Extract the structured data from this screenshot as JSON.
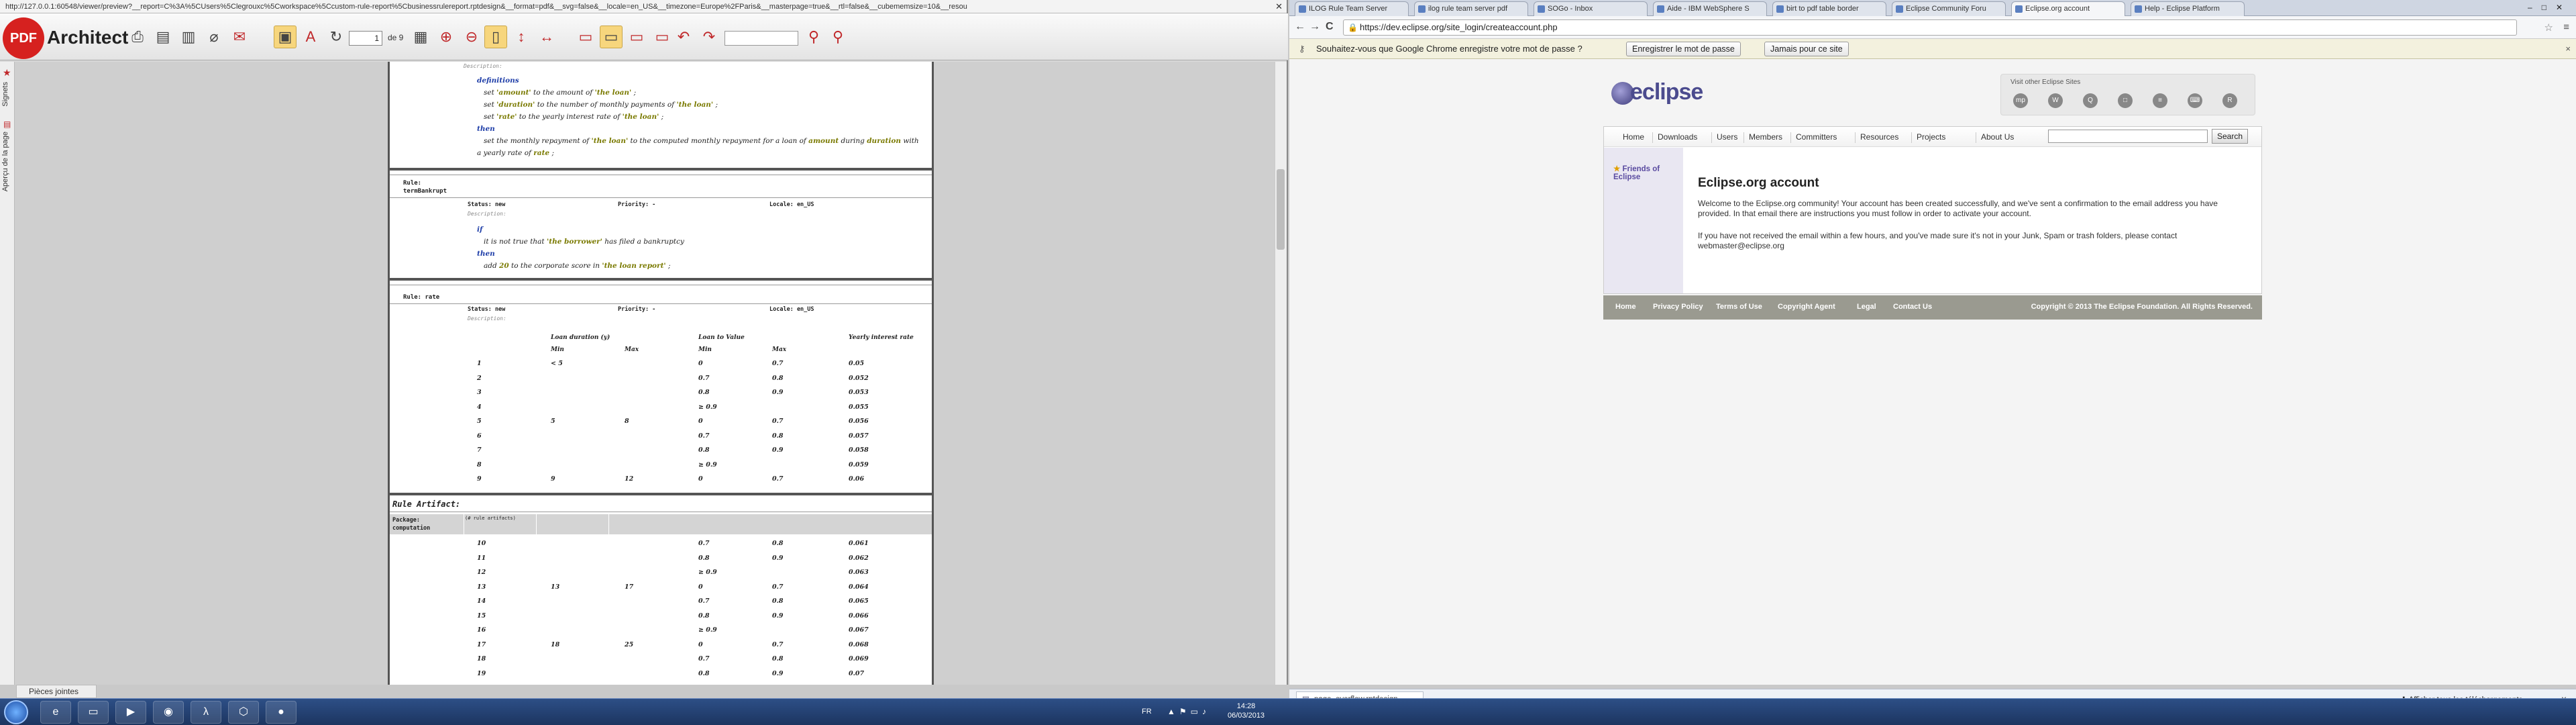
{
  "left_window": {
    "url": "http://127.0.0.1:60548/viewer/preview?__report=C%3A%5CUsers%5Clegrouxc%5Cworkspace%5Ccustom-rule-report%5Cbusinessrulereport.rptdesign&__format=pdf&__svg=false&__locale=en_US&__timezone=Europe%2FParis&__masterpage=true&__rtl=false&__cubememsize=10&__resou",
    "close": "✕",
    "brand": "Architect",
    "logo_text": "PDF",
    "page_current": "1",
    "page_of": "de 9",
    "side_tabs": [
      "Signets",
      "Aperçu de la page"
    ],
    "attachments": "Pièces jointes",
    "toolbar_icons": [
      "print-icon",
      "save-icon",
      "scan-icon",
      "attach-icon",
      "email-icon",
      "highlight-icon",
      "text-icon",
      "rotate-icon",
      "zoom-in-icon",
      "zoom-out-icon",
      "single-page-icon",
      "fit-height-icon",
      "fit-width-icon",
      "layout1-icon",
      "layout2-icon",
      "layout3-icon",
      "layout4-icon",
      "undo-icon",
      "redo-icon",
      "find-icon",
      "find-next-icon"
    ]
  },
  "document": {
    "description_label": "Description:",
    "rule1": {
      "definitions_kw": "definitions",
      "lines": [
        {
          "pre": "set ",
          "var": "'amount'",
          "post": " to the amount of ",
          "var2": "'the loan'",
          "end": " ;"
        },
        {
          "pre": "set ",
          "var": "'duration'",
          "post": " to the number of monthly payments of ",
          "var2": "'the loan'",
          "end": " ;"
        },
        {
          "pre": "set ",
          "var": "'rate'",
          "post": " to the yearly interest rate of ",
          "var2": "'the loan'",
          "end": " ;"
        }
      ],
      "then_kw": "then",
      "then_line1_a": "set the monthly repayment of ",
      "then_line1_b": "'the loan'",
      "then_line1_c": " to the computed monthly repayment for a loan of ",
      "then_line1_d": "amount",
      "then_line1_e": " during ",
      "then_line1_f": "duration",
      "then_line1_g": " with",
      "then_line2_a": "a yearly rate of ",
      "then_line2_b": "rate",
      "then_line2_c": " ;"
    },
    "rule2": {
      "label": "Rule:",
      "name": "termBankrupt",
      "status_label": "Status: new",
      "priority_label": "Priority: -",
      "locale_label": "Locale: en_US",
      "if_kw": "if",
      "if_line_a": "it is not true that ",
      "if_line_b": "'the borrower'",
      "if_line_c": " has filed a bankruptcy",
      "then_kw": "then",
      "then_line_a": "add ",
      "then_line_b": "20",
      "then_line_c": " to the corporate score in ",
      "then_line_d": "'the loan report'",
      "then_line_e": " ;"
    },
    "rule3": {
      "label": "Rule: rate",
      "status_label": "Status: new",
      "priority_label": "Priority: -",
      "locale_label": "Locale: en_US",
      "headers": {
        "loan_duration": "Loan duration (y)",
        "loan_to_value": "Loan to Value",
        "yearly_rate": "Yearly interest rate",
        "min": "Min",
        "max": "Max",
        "min2": "Min",
        "max2": "Max"
      },
      "rows": [
        [
          "1",
          "< 5",
          "",
          "0",
          "0.7",
          "0.05"
        ],
        [
          "2",
          "",
          "",
          "0.7",
          "0.8",
          "0.052"
        ],
        [
          "3",
          "",
          "",
          "0.8",
          "0.9",
          "0.053"
        ],
        [
          "4",
          "",
          "",
          "≥ 0.9",
          "",
          "0.055"
        ],
        [
          "5",
          "5",
          "8",
          "0",
          "0.7",
          "0.056"
        ],
        [
          "6",
          "",
          "",
          "0.7",
          "0.8",
          "0.057"
        ],
        [
          "7",
          "",
          "",
          "0.8",
          "0.9",
          "0.058"
        ],
        [
          "8",
          "",
          "",
          "≥ 0.9",
          "",
          "0.059"
        ],
        [
          "9",
          "9",
          "12",
          "0",
          "0.7",
          "0.06"
        ]
      ]
    },
    "artifact": {
      "title": "Rule Artifact:",
      "package_label": "Package:",
      "package_value": "computation",
      "sub_header": "(# rule artifacts)",
      "rows": [
        [
          "10",
          "",
          "",
          "0.7",
          "0.8",
          "0.061"
        ],
        [
          "11",
          "",
          "",
          "0.8",
          "0.9",
          "0.062"
        ],
        [
          "12",
          "",
          "",
          "≥ 0.9",
          "",
          "0.063"
        ],
        [
          "13",
          "13",
          "17",
          "0",
          "0.7",
          "0.064"
        ],
        [
          "14",
          "",
          "",
          "0.7",
          "0.8",
          "0.065"
        ],
        [
          "15",
          "",
          "",
          "0.8",
          "0.9",
          "0.066"
        ],
        [
          "16",
          "",
          "",
          "≥ 0.9",
          "",
          "0.067"
        ],
        [
          "17",
          "18",
          "25",
          "0",
          "0.7",
          "0.068"
        ],
        [
          "18",
          "",
          "",
          "0.7",
          "0.8",
          "0.069"
        ],
        [
          "19",
          "",
          "",
          "0.8",
          "0.9",
          "0.07"
        ]
      ]
    }
  },
  "browser": {
    "tabs": [
      "ILOG Rule Team Server",
      "ilog rule team server pdf",
      "SOGo - Inbox",
      "Aide - IBM WebSphere S",
      "birt to pdf table border",
      "Eclipse Community Foru",
      "Eclipse.org account",
      "Help - Eclipse Platform"
    ],
    "active_tab": 6,
    "url": "https://dev.eclipse.org/site_login/createaccount.php",
    "nav_back": "←",
    "nav_forward": "→",
    "nav_reload": "C",
    "star": "☆",
    "menu": "≡",
    "password_prompt": "Souhaitez-vous que Google Chrome enregistre votre mot de passe ?",
    "btn_save": "Enregistrer le mot de passe",
    "btn_never": "Jamais pour ce site",
    "close": "×"
  },
  "eclipse": {
    "logo": "eclipse",
    "other_sites": "Visit other Eclipse Sites",
    "site_icons": [
      "mp",
      "W",
      "Q",
      "□",
      "≡",
      "⌨",
      "R"
    ],
    "nav": [
      "Home",
      "Downloads",
      "Users",
      "Members",
      "Committers",
      "Resources",
      "Projects",
      "About Us"
    ],
    "search_btn": "Search",
    "friends": "Friends of Eclipse",
    "title": "Eclipse.org account",
    "para1": "Welcome to the Eclipse.org community! Your account has been created successfully, and we've sent a confirmation to the email address you have provided. In that email there are instructions you must follow in order to activate your account.",
    "para2": "If you have not received the email within a few hours, and you've made sure it's not in your Junk, Spam or trash folders, please contact webmaster@eclipse.org",
    "footer_links": [
      "Home",
      "Privacy Policy",
      "Terms of Use",
      "Copyright Agent",
      "Legal",
      "Contact Us"
    ],
    "copyright": "Copyright © 2013 The Eclipse Foundation. All Rights Reserved."
  },
  "downloads": {
    "item": "page_overflow.rptdesign",
    "show_all": "Afficher tous les téléchargements...",
    "close": "×"
  },
  "taskbar": {
    "lang": "FR",
    "time": "14:28",
    "date": "06/03/2013"
  }
}
